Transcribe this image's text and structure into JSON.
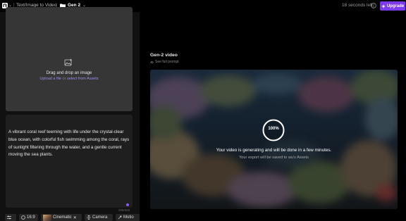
{
  "topbar": {
    "logo_icon": "runway-logo-icon",
    "tool_label": "Text/Image to Video",
    "folder_icon": "folder-icon",
    "folder_name": "Gen 2",
    "credits_text": "18 seconds left",
    "upgrade_label": "Upgrade",
    "accent_color": "#7c3aed"
  },
  "left_panel": {
    "dropzone": {
      "title": "Drag and drop an image",
      "upload_link": "Upload a file",
      "or_text": "or",
      "assets_link": "select from Assets"
    },
    "prompt": {
      "text": "A vibrant coral reef teeming with life under the crystal-clear blue ocean, with colorful fish swimming among the coral, rays of sunlight filtering through the water, and a gentle current moving the sea plants.",
      "char_count": "206/320"
    },
    "toolbar": {
      "aspect_ratio": "16:9",
      "style_label": "Cinematic",
      "camera_label": "Camera",
      "motion_label": "Motio"
    }
  },
  "video": {
    "title": "Gen-2 video",
    "see_prompt": "See full prompt",
    "progress": "100%",
    "status_main": "Your video is generating and will be done in a few minutes.",
    "status_sub": "Your export will be saved to wu's Assets"
  }
}
